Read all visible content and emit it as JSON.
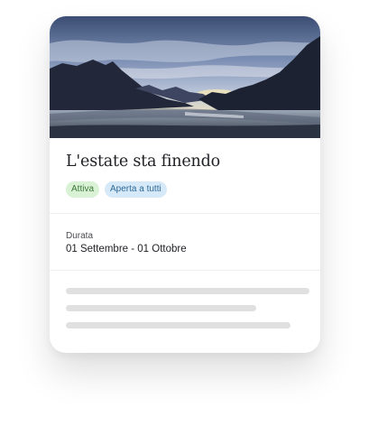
{
  "card": {
    "title": "L'estate sta finendo",
    "badges": [
      {
        "label": "Attiva",
        "color": "#d9f2d6"
      },
      {
        "label": "Aperta a tutti",
        "color": "#d6e9f8"
      }
    ],
    "duration_label": "Durata",
    "duration_value": "01 Settembre - 01 Ottobre"
  },
  "colors": {
    "skeleton": "#e0e0e0",
    "divider": "#efefef"
  }
}
